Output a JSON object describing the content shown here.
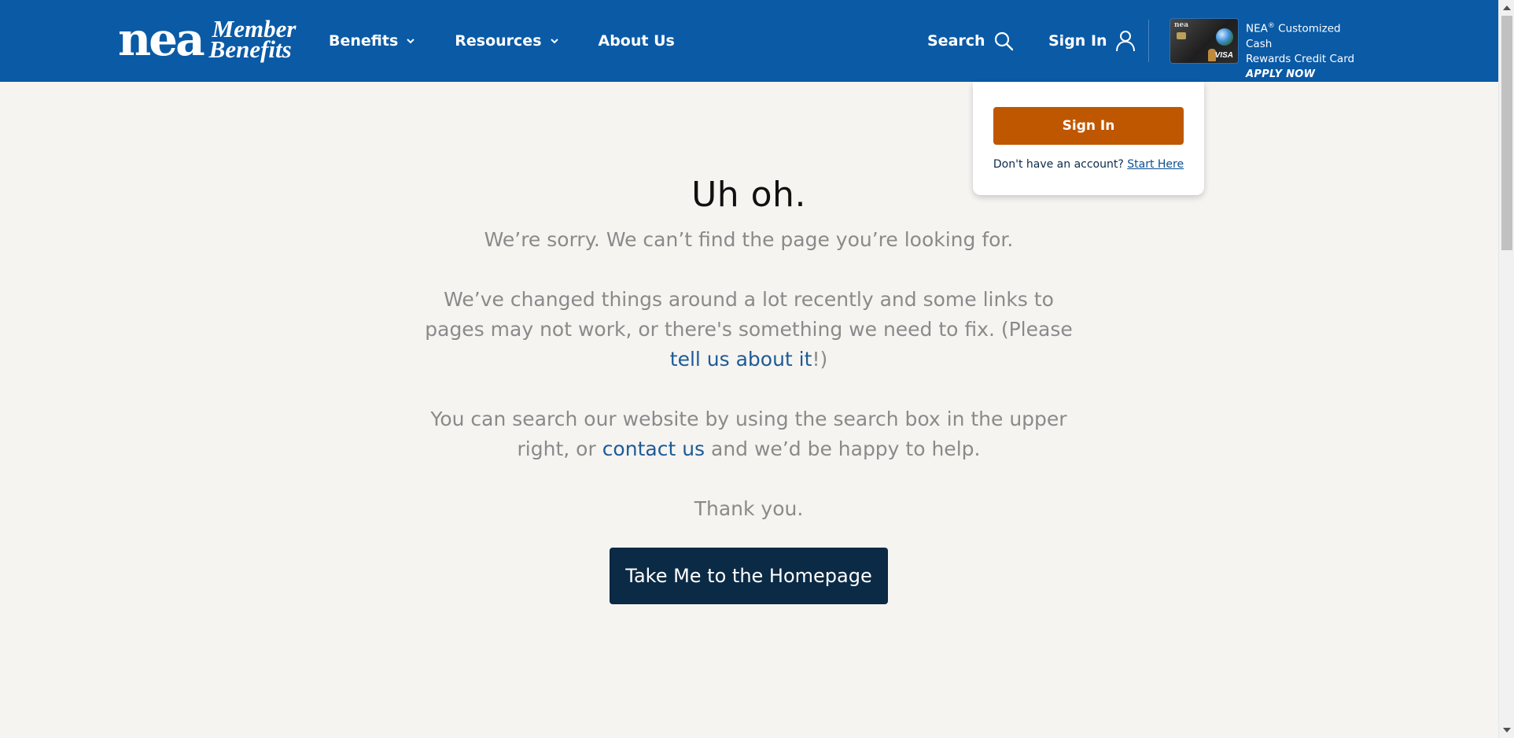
{
  "header": {
    "logo": {
      "primary": "nea",
      "line1": "Member",
      "line2": "Benefits"
    },
    "nav": [
      {
        "label": "Benefits",
        "has_dropdown": true
      },
      {
        "label": "Resources",
        "has_dropdown": true
      },
      {
        "label": "About Us",
        "has_dropdown": false
      }
    ],
    "search_label": "Search",
    "signin_label": "Sign In",
    "promo": {
      "card_brand": "nea",
      "card_network": "VISA",
      "line1": "NEA",
      "line1_sup": "®",
      "line1_rest": " Customized Cash",
      "line2": "Rewards Credit Card",
      "cta": "APPLY NOW"
    }
  },
  "signin_dropdown": {
    "button_label": "Sign In",
    "prompt": "Don't have an account?",
    "link_label": "Start Here"
  },
  "main": {
    "heading": "Uh oh.",
    "p1": "We’re sorry. We can’t find the page you’re looking for.",
    "p2_before": "We’ve changed things around a lot recently and some links to pages may not work, or there's something we need to fix. (Please ",
    "p2_link": "tell us about it",
    "p2_after": "!)",
    "p3_before": "You can search our website by using the search box in the upper right, or ",
    "p3_link": "contact us",
    "p3_after": " and we’d be happy to help.",
    "p4": "Thank you.",
    "button_label": "Take Me to the Homepage"
  },
  "colors": {
    "header_bg": "#0a5aa6",
    "page_bg": "#f5f4f1",
    "signin_button": "#bf5700",
    "home_button": "#0b2a45",
    "link": "#1e5b97"
  },
  "icons": {
    "search": "search-icon",
    "user": "user-icon",
    "chevron": "chevron-down-icon"
  }
}
